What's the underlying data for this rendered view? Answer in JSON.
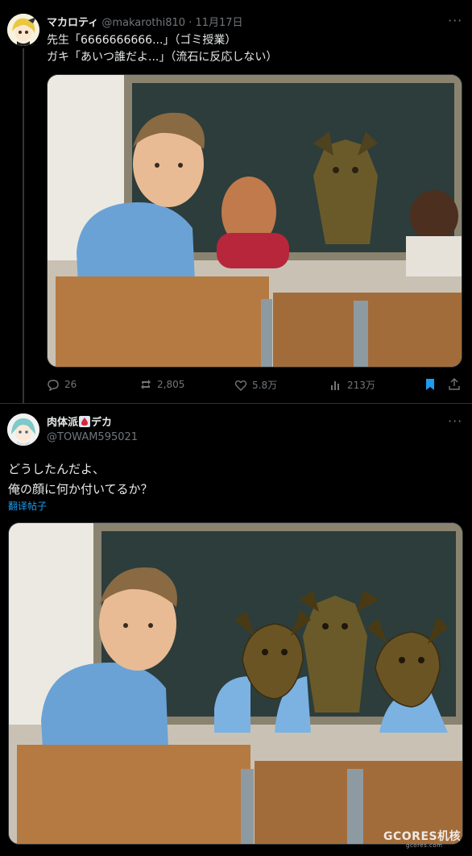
{
  "tweet1": {
    "author_name": "マカロティ",
    "author_handle": "@makarothi810",
    "time": "· 11月17日",
    "text": "先生「6666666666...」（ゴミ授業）\nガキ「あいつ誰だよ...」（流石に反応しない）",
    "image": {
      "description_icon": "meme-classroom-photo-icon"
    },
    "stats": {
      "replies": "26",
      "reposts": "2,805",
      "likes": "5.8万",
      "views": "213万"
    }
  },
  "tweet2": {
    "author_name": "肉体派",
    "author_name_suffix": "デカ",
    "author_handle": "@TOWAM595021",
    "text": "どうしたんだよ、\n俺の顔に何か付いてるか？",
    "translate_label": "翻译帖子"
  },
  "watermark": {
    "brand": "GCORES机核",
    "sub": "gcores.com"
  },
  "colors": {
    "background": "#000000",
    "text": "#e7e9ea",
    "muted": "#71767b",
    "link": "#1d9bf0",
    "bookmark": "#1d9bf0"
  }
}
